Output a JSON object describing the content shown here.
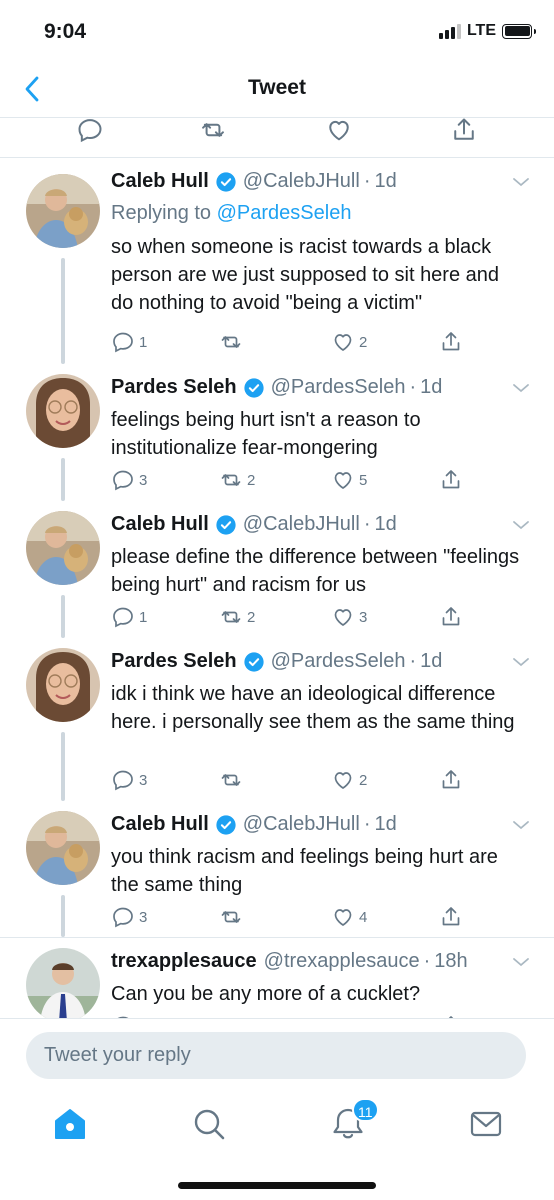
{
  "status_bar": {
    "time": "9:04",
    "network": "LTE"
  },
  "nav": {
    "title": "Tweet"
  },
  "colors": {
    "accent": "#1da1f2",
    "text": "#14171a",
    "muted": "#657786",
    "divider": "#e1e8ed"
  },
  "tweets": [
    {
      "name": "Caleb Hull",
      "handle": "@CalebJHull",
      "dot": "·",
      "time": "1d",
      "replying_prefix": "Replying to ",
      "replying_to": "@PardesSeleh",
      "text": "so when someone is racist towards a black person are we just supposed to sit here and do nothing to avoid \"being a victim\"",
      "replies": "1",
      "retweets": "",
      "likes": "2"
    },
    {
      "name": "Pardes Seleh",
      "handle": "@PardesSeleh",
      "dot": "·",
      "time": "1d",
      "text": "feelings being hurt isn't a reason to institutionalize fear-mongering",
      "replies": "3",
      "retweets": "2",
      "likes": "5"
    },
    {
      "name": "Caleb Hull",
      "handle": "@CalebJHull",
      "dot": "·",
      "time": "1d",
      "text": "please define the difference between \"feelings being hurt\" and racism for us",
      "replies": "1",
      "retweets": "2",
      "likes": "3"
    },
    {
      "name": "Pardes Seleh",
      "handle": "@PardesSeleh",
      "dot": "·",
      "time": "1d",
      "text": "idk i think we have an ideological difference here. i personally see them as the same thing",
      "replies": "3",
      "retweets": "",
      "likes": "2"
    },
    {
      "name": "Caleb Hull",
      "handle": "@CalebJHull",
      "dot": "·",
      "time": "1d",
      "text": "you think racism and feelings being hurt are the same thing",
      "replies": "3",
      "retweets": "",
      "likes": "4"
    },
    {
      "name": "trexapplesauce",
      "handle": "@trexapplesauce",
      "dot": "·",
      "time": "18h",
      "text": "Can you be any more of a cucklet?",
      "replies": "",
      "retweets": "",
      "likes": ""
    }
  ],
  "reply": {
    "placeholder": "Tweet your reply"
  },
  "tabbar": {
    "notifications_count": "11"
  }
}
